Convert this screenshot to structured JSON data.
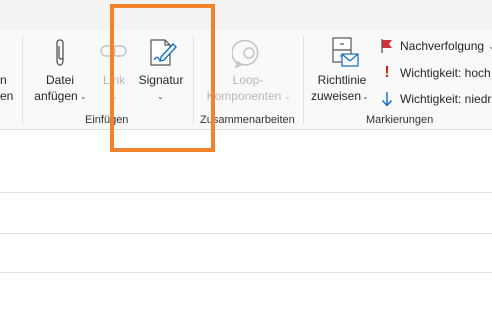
{
  "ribbon": {
    "left_cut": {
      "line1": "n",
      "line2": "en"
    },
    "insert_group": {
      "label": "Einfügen",
      "attach_file": {
        "line1": "Datei",
        "line2": "anfügen"
      },
      "link": {
        "label": "Link"
      },
      "signature": {
        "label": "Signatur"
      }
    },
    "collab_group": {
      "label": "Zusammenarbeiten",
      "loop": {
        "line1": "Loop-",
        "line2": "Komponenten"
      }
    },
    "tags_group": {
      "label": "Markierungen",
      "assign_policy": {
        "line1": "Richtlinie",
        "line2": "zuweisen"
      },
      "follow_up": "Nachverfolgung",
      "importance_high": "Wichtigkeit: hoch",
      "importance_low": "Wichtigkeit: niedrig"
    }
  },
  "colors": {
    "highlight": "#f0832b",
    "flag": "#d13438",
    "importance_high": "#c42b1c",
    "importance_low": "#0f6cbd"
  }
}
